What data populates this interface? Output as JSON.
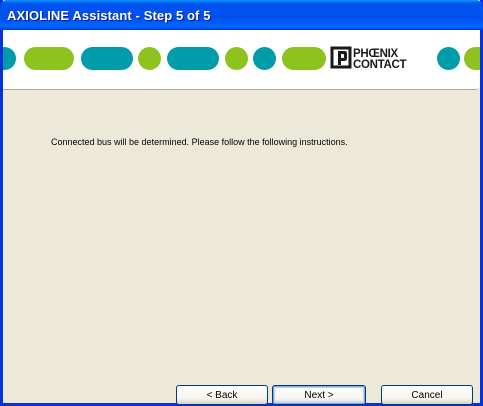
{
  "window": {
    "title": "AXIOLINE Assistant - Step 5 of 5"
  },
  "banner": {
    "logo_text_line1": "PHŒNIX",
    "logo_text_line2": "CONTACT",
    "colors": {
      "green": "#8dc21f",
      "teal": "#009ca9",
      "logo_dark": "#1a1a1a"
    }
  },
  "main": {
    "instruction": "Connected bus will be determined. Please follow the following instructions."
  },
  "buttons": {
    "back": "< Back",
    "next": "Next >",
    "cancel": "Cancel"
  },
  "colors": {
    "titlebar": "#0050ee",
    "dialog_bg": "#ece9d8",
    "border": "#0831d9"
  }
}
